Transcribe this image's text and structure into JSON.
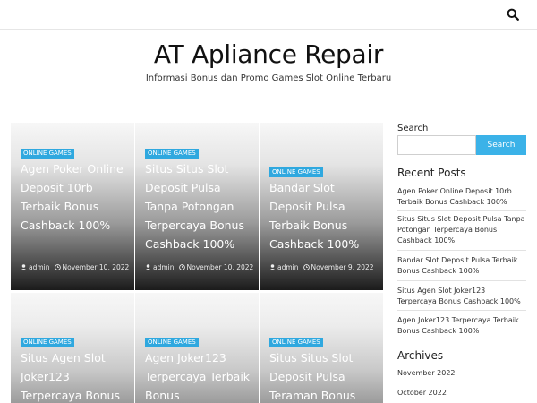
{
  "header": {
    "search_icon": "search-icon",
    "site_title": "AT Apliance Repair",
    "site_description": "Informasi Bonus dan Promo Games Slot Online Terbaru"
  },
  "posts": [
    {
      "category": "ONLINE GAMES",
      "title": "Agen Poker Online Deposit 10rb Terbaik Bonus Cashback 100%",
      "author": "admin",
      "date": "November 10, 2022"
    },
    {
      "category": "ONLINE GAMES",
      "title": "Situs Situs Slot Deposit Pulsa Tanpa Potongan Terpercaya Bonus Cashback 100%",
      "author": "admin",
      "date": "November 10, 2022"
    },
    {
      "category": "ONLINE GAMES",
      "title": "Bandar Slot Deposit Pulsa Terbaik Bonus Cashback 100%",
      "author": "admin",
      "date": "November 9, 2022"
    },
    {
      "category": "ONLINE GAMES",
      "title": "Situs Agen Slot Joker123 Terpercaya Bonus"
    },
    {
      "category": "ONLINE GAMES",
      "title": "Agen Joker123 Terpercaya Terbaik Bonus"
    },
    {
      "category": "ONLINE GAMES",
      "title": "Situs Situs Slot Deposit Pulsa Teraman Bonus"
    }
  ],
  "sidebar": {
    "search_label": "Search",
    "search_placeholder": "",
    "search_button": "Search",
    "recent_title": "Recent Posts",
    "recent_posts": [
      "Agen Poker Online Deposit 10rb Terbaik Bonus Cashback 100%",
      "Situs Situs Slot Deposit Pulsa Tanpa Potongan Terpercaya Bonus Cashback 100%",
      "Bandar Slot Deposit Pulsa Terbaik Bonus Cashback 100%",
      "Situs Agen Slot Joker123 Terpercaya Bonus Cashback 100%",
      "Agen Joker123 Terpercaya Terbaik Bonus Cashback 100%"
    ],
    "archives_title": "Archives",
    "archives": [
      "November 2022",
      "October 2022"
    ]
  },
  "colors": {
    "accent": "#3bb2e8",
    "category_badge": "#2fa8df"
  }
}
